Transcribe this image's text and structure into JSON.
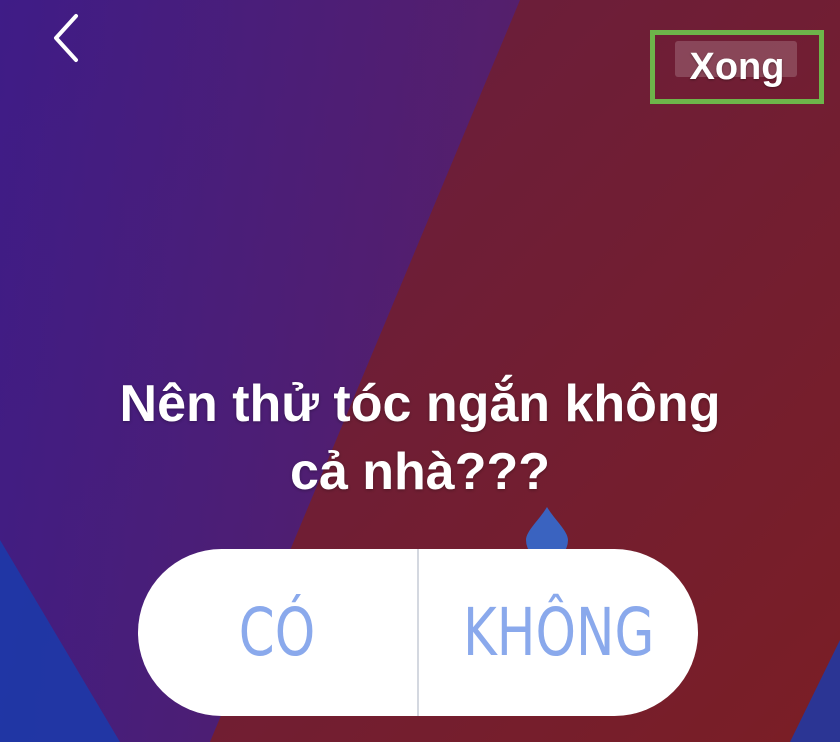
{
  "header": {
    "back_icon": "chevron-left-icon",
    "done_label": "Xong"
  },
  "poll": {
    "question_line1": "Nên thử tóc ngắn không",
    "question_line2": "cả nhà???",
    "options": [
      {
        "label": "CÓ"
      },
      {
        "label": "KHÔNG"
      }
    ]
  },
  "colors": {
    "accent_highlight": "#6db54a",
    "option_text": "#8aa9ec",
    "slider_handle": "#3a63c0",
    "background_purple": "#3c1a7a",
    "background_red": "#7a1e2a"
  }
}
